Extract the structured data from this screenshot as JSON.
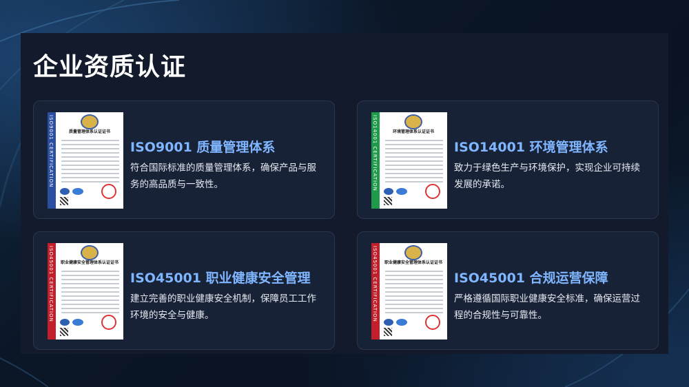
{
  "page": {
    "title": "企业资质认证"
  },
  "colors": {
    "accent": "#7fb6ff",
    "blue_stripe": "#2a4fa0",
    "green_stripe": "#1f9a4a",
    "red_stripe": "#c21f2a"
  },
  "certificates": [
    {
      "title": "ISO9001 质量管理体系",
      "description": "符合国际标准的质量管理体系，确保产品与服务的高品质与一致性。",
      "image": {
        "stripe_text": "ISO9001 CERTIFICATION",
        "heading": "质量管理体系认证证书",
        "stripe_color": "blue"
      }
    },
    {
      "title": "ISO14001 环境管理体系",
      "description": "致力于绿色生产与环境保护，实现企业可持续发展的承诺。",
      "image": {
        "stripe_text": "ISO14001 CERTIFICATION",
        "heading": "环境管理体系认证证书",
        "stripe_color": "green"
      }
    },
    {
      "title": "ISO45001 职业健康安全管理",
      "description": "建立完善的职业健康安全机制，保障员工工作环境的安全与健康。",
      "image": {
        "stripe_text": "ISO45001 CERTIFICATION",
        "heading": "职业健康安全管理体系认证证书",
        "stripe_color": "red"
      }
    },
    {
      "title": "ISO45001 合规运营保障",
      "description": "严格遵循国际职业健康安全标准，确保运营过程的合规性与可靠性。",
      "image": {
        "stripe_text": "ISO45001 CERTIFICATION",
        "heading": "职业健康安全管理体系认证证书",
        "stripe_color": "red"
      }
    }
  ]
}
